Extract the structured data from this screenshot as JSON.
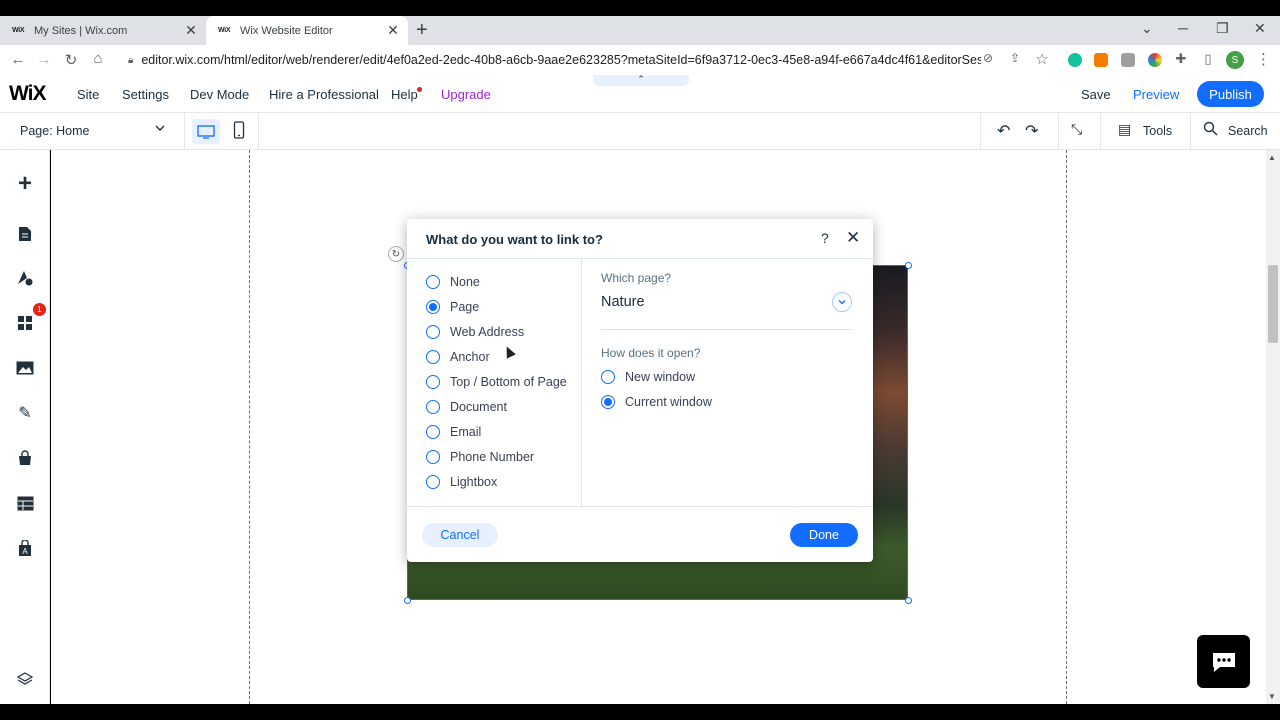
{
  "browser": {
    "tabs": [
      {
        "favicon": "WiX",
        "title": "My Sites | Wix.com"
      },
      {
        "favicon": "WiX",
        "title": "Wix Website Editor"
      }
    ],
    "url": "editor.wix.com/html/editor/web/renderer/edit/4ef0a2ed-2edc-40b8-a6cb-9aae2e623285?metaSiteId=6f9a3712-0ec3-45e8-a94f-e667a4dc4f61&editorSessionI...",
    "profile_initial": "S"
  },
  "wix": {
    "logo": "WiX",
    "menu": [
      "Site",
      "Settings",
      "Dev Mode",
      "Hire a Professional",
      "Help",
      "Upgrade"
    ],
    "save": "Save",
    "preview": "Preview",
    "publish": "Publish",
    "page_selector": "Page: Home",
    "tools": "Tools",
    "search": "Search",
    "apps_badge": "1"
  },
  "dialog": {
    "title": "What do you want to link to?",
    "help": "?",
    "options": [
      "None",
      "Page",
      "Web Address",
      "Anchor",
      "Top / Bottom of Page",
      "Document",
      "Email",
      "Phone Number",
      "Lightbox"
    ],
    "selected_option": "Page",
    "which_page_label": "Which page?",
    "which_page_value": "Nature",
    "open_label": "How does it open?",
    "open_options": [
      "New window",
      "Current window"
    ],
    "selected_open": "Current window",
    "cancel": "Cancel",
    "done": "Done"
  },
  "colors": {
    "accent": "#116dff",
    "upgrade": "#9a27d5",
    "badge": "#e62214"
  }
}
